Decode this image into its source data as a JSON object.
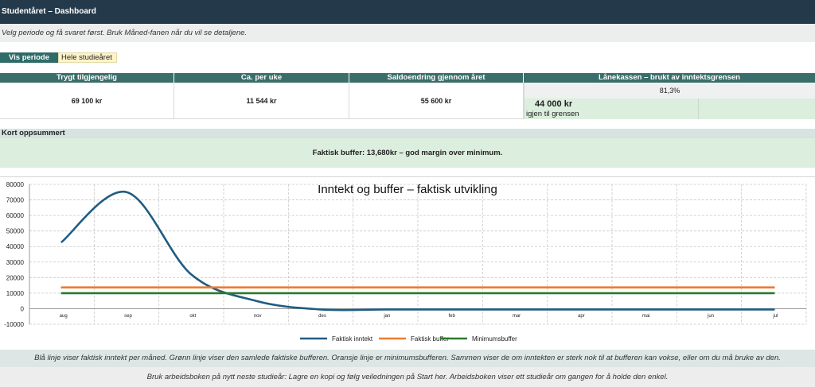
{
  "header": {
    "title": "Studentåret – Dashboard",
    "subtitle": "Velg periode og få svaret først. Bruk Måned-fanen når du vil se detaljene."
  },
  "period": {
    "label": "Vis periode",
    "value": "Hele studieåret"
  },
  "kpis": [
    {
      "header": "Trygt tilgjengelig",
      "value": "69 100 kr"
    },
    {
      "header": "Ca. per uke",
      "value": "11 544 kr"
    },
    {
      "header": "Saldoendring gjennom året",
      "value": "55 600 kr"
    }
  ],
  "lanekassen": {
    "header": "Lånekassen – brukt av inntektsgrensen",
    "percent": "81,3%",
    "amount": "44 000 kr",
    "sub": "igjen til grensen"
  },
  "summary": {
    "header": "Kort oppsummert",
    "text": "Faktisk buffer: 13,680kr – god margin over minimum."
  },
  "chart_data": {
    "type": "line",
    "title": "Inntekt og buffer – faktisk utvikling",
    "categories": [
      "aug",
      "sep",
      "okt",
      "nov",
      "des",
      "jan",
      "feb",
      "mar",
      "apr",
      "mai",
      "jun",
      "jul"
    ],
    "ylim": [
      -10000,
      80000
    ],
    "yticks": [
      -10000,
      0,
      10000,
      20000,
      30000,
      40000,
      50000,
      60000,
      70000,
      80000
    ],
    "grid": true,
    "legend_position": "bottom",
    "series": [
      {
        "name": "Faktisk inntekt",
        "color": "#1f5c82",
        "smooth": true,
        "values": [
          43000,
          75000,
          22000,
          5000,
          -500,
          -500,
          -500,
          -500,
          -500,
          -500,
          -500,
          -500
        ]
      },
      {
        "name": "Faktisk buffer",
        "color": "#ee7a30",
        "smooth": false,
        "values": [
          13680,
          13680,
          13680,
          13680,
          13680,
          13680,
          13680,
          13680,
          13680,
          13680,
          13680,
          13680
        ]
      },
      {
        "name": "Minimumsbuffer",
        "color": "#2a7a2a",
        "smooth": false,
        "values": [
          10000,
          10000,
          10000,
          10000,
          10000,
          10000,
          10000,
          10000,
          10000,
          10000,
          10000,
          10000
        ]
      }
    ]
  },
  "notes": {
    "chart_note": "Blå linje viser faktisk inntekt per måned. Grønn linje viser den samlede faktiske bufferen. Oransje linje er minimumsbufferen. Sammen viser de om inntekten er sterk nok til at bufferen kan vokse, eller om du må bruke av den.",
    "footer": "Bruk arbeidsboken på nytt neste studieår: Lagre en kopi og følg veiledningen på Start her. Arbeidsboken viser ett studieår om gangen for å holde den enkel."
  }
}
